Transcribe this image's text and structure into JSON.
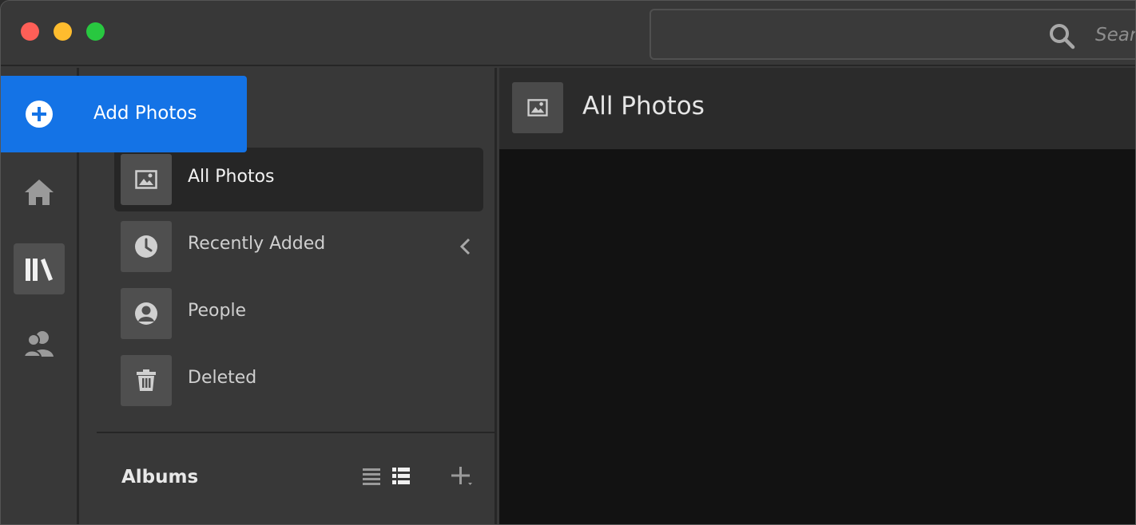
{
  "search": {
    "placeholder": "Search"
  },
  "rail": {
    "items": [
      {
        "icon": "home-icon"
      },
      {
        "icon": "library-icon",
        "active": true
      },
      {
        "icon": "people-shared-icon"
      }
    ]
  },
  "sidebar": {
    "items": [
      {
        "label": "All Photos",
        "icon": "photo-icon",
        "selected": true
      },
      {
        "label": "Recently Added",
        "icon": "clock-icon"
      },
      {
        "label": "People",
        "icon": "person-icon"
      },
      {
        "label": "Deleted",
        "icon": "trash-icon"
      }
    ],
    "albums_title": "Albums"
  },
  "main": {
    "title": "All Photos"
  },
  "add_photos": {
    "label": "Add Photos"
  },
  "colors": {
    "accent": "#1473e6",
    "background": "#383838",
    "content": "#121212"
  }
}
